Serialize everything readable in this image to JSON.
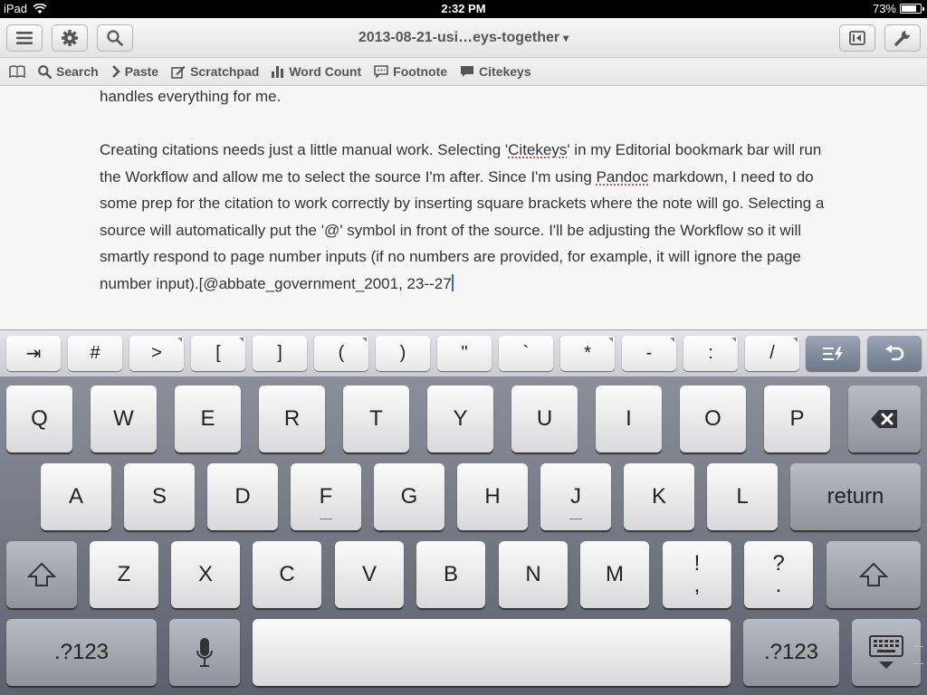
{
  "status_bar": {
    "device": "iPad",
    "time": "2:32 PM",
    "battery": "73%",
    "battery_level": 0.73
  },
  "nav": {
    "title": "2013-08-21-usi…eys-together",
    "title_caret": "▾"
  },
  "bookmarks": [
    {
      "label": "Search",
      "icon": "search-icon"
    },
    {
      "label": "Paste",
      "icon": "chevron-right-icon"
    },
    {
      "label": "Scratchpad",
      "icon": "edit-icon"
    },
    {
      "label": "Word Count",
      "icon": "bar-chart-icon"
    },
    {
      "label": "Footnote",
      "icon": "speech-bubble-icon"
    },
    {
      "label": "Citekeys",
      "icon": "speech-bubble-filled-icon"
    }
  ],
  "editor": {
    "para1": "handles everything for me.",
    "p2_a": "Creating citations needs just a little manual work. Selecting '",
    "p2_citekeys": "Citekeys",
    "p2_b": "' in my Editorial bookmark bar will run the Workflow and allow me to select the source I'm after. Since I'm using ",
    "p2_pandoc": "Pandoc",
    "p2_c": " markdown, I need to do some prep for the citation to work correctly by inserting square brackets where the note will go. Selecting a source will automatically put the '@' symbol in front of the source. I'll be adjusting the Workflow so it will smartly respond to page number inputs (if no numbers are provided, for example, it will ignore the page number input).[@abbate_government_2001,  23--27"
  },
  "extra_keys": [
    "⇥",
    "#",
    ">",
    "[",
    "]",
    "(",
    ")",
    "\"",
    "`",
    "*",
    "-",
    ":",
    "/"
  ],
  "keyboard": {
    "row1": [
      "Q",
      "W",
      "E",
      "R",
      "T",
      "Y",
      "U",
      "I",
      "O",
      "P"
    ],
    "row2": [
      "A",
      "S",
      "D",
      "F",
      "G",
      "H",
      "J",
      "K",
      "L"
    ],
    "row3": [
      "Z",
      "X",
      "C",
      "V",
      "B",
      "N",
      "M"
    ],
    "punct1_top": "!",
    "punct1_bottom": ",",
    "punct2_top": "?",
    "punct2_bottom": ".",
    "return": "return",
    "numbers": ".?123"
  }
}
